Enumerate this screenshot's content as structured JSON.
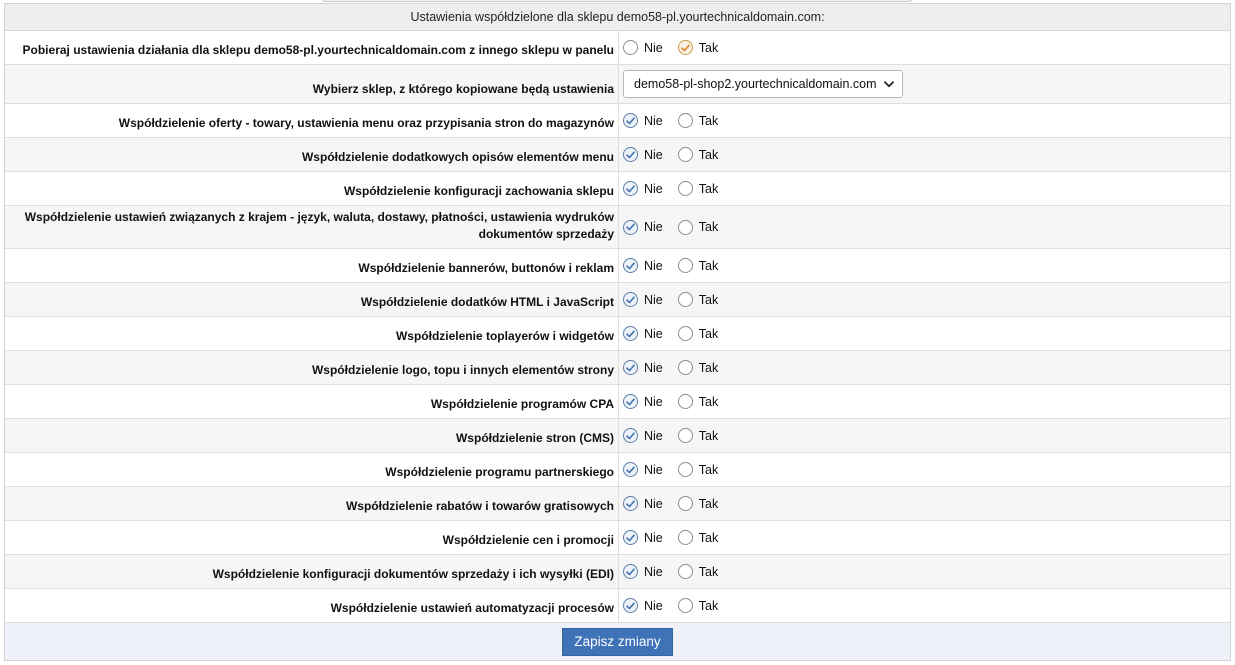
{
  "header": {
    "title": "Ustawienia współdzielone dla sklepu demo58-pl.yourtechnicaldomain.com:"
  },
  "options": {
    "no": "Nie",
    "yes": "Tak"
  },
  "rows": [
    {
      "label": "Pobieraj ustawienia działania dla sklepu demo58-pl.yourtechnicaldomain.com z innego sklepu w panelu",
      "type": "radio",
      "selected": "yes"
    },
    {
      "label": "Wybierz sklep, z którego kopiowane będą ustawienia",
      "type": "select",
      "selected_value": "demo58-pl-shop2.yourtechnicaldomain.com"
    },
    {
      "label": "Współdzielenie oferty - towary, ustawienia menu oraz przypisania stron do magazynów",
      "type": "radio",
      "selected": "no"
    },
    {
      "label": "Współdzielenie dodatkowych opisów elementów menu",
      "type": "radio",
      "selected": "no"
    },
    {
      "label": "Współdzielenie konfiguracji zachowania sklepu",
      "type": "radio",
      "selected": "no"
    },
    {
      "label": "Współdzielenie ustawień związanych z krajem - język, waluta, dostawy, płatności, ustawienia wydruków dokumentów sprzedaży",
      "type": "radio",
      "selected": "no"
    },
    {
      "label": "Współdzielenie bannerów, buttonów i reklam",
      "type": "radio",
      "selected": "no"
    },
    {
      "label": "Współdzielenie dodatków HTML i JavaScript",
      "type": "radio",
      "selected": "no"
    },
    {
      "label": "Współdzielenie toplayerów i widgetów",
      "type": "radio",
      "selected": "no"
    },
    {
      "label": "Współdzielenie logo, topu i innych elementów strony",
      "type": "radio",
      "selected": "no"
    },
    {
      "label": "Współdzielenie programów CPA",
      "type": "radio",
      "selected": "no"
    },
    {
      "label": "Współdzielenie stron (CMS)",
      "type": "radio",
      "selected": "no"
    },
    {
      "label": "Współdzielenie programu partnerskiego",
      "type": "radio",
      "selected": "no"
    },
    {
      "label": "Współdzielenie rabatów i towarów gratisowych",
      "type": "radio",
      "selected": "no"
    },
    {
      "label": "Współdzielenie cen i promocji",
      "type": "radio",
      "selected": "no"
    },
    {
      "label": "Współdzielenie konfiguracji dokumentów sprzedaży i ich wysyłki (EDI)",
      "type": "radio",
      "selected": "no"
    },
    {
      "label": "Współdzielenie ustawień automatyzacji procesów",
      "type": "radio",
      "selected": "no"
    }
  ],
  "footer": {
    "save_label": "Zapisz zmiany"
  },
  "colors": {
    "button": "#3f73b8",
    "check_blue": "#4a78b4",
    "check_orange": "#d98a2b"
  }
}
